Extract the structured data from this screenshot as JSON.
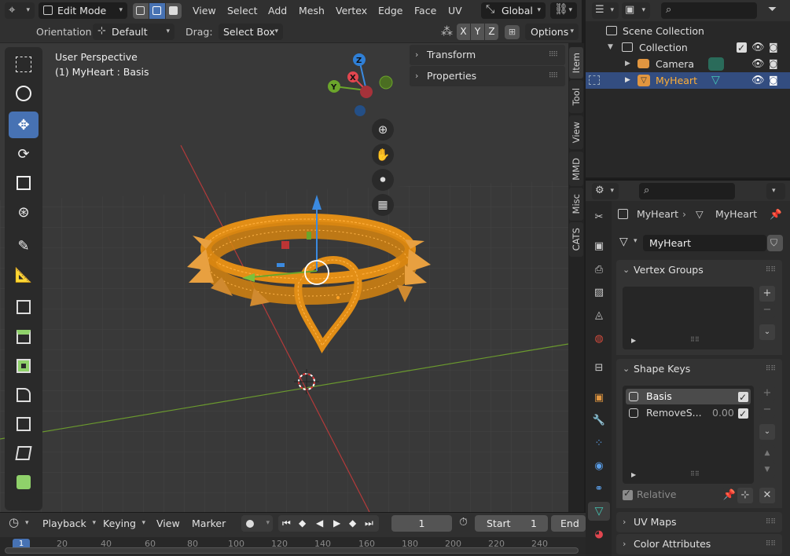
{
  "header": {
    "mode_label": "Edit Mode",
    "menus": [
      "View",
      "Select",
      "Add",
      "Mesh",
      "Vertex",
      "Edge",
      "Face",
      "UV"
    ],
    "transform_orientation": "Global",
    "orientation_label": "Orientation:",
    "orientation_value": "Default",
    "drag_label": "Drag:",
    "drag_value": "Select Box",
    "axis_x": "X",
    "axis_y": "Y",
    "axis_z": "Z",
    "options_label": "Options"
  },
  "viewport": {
    "perspective_label": "User Perspective",
    "object_label": "(1) MyHeart : Basis",
    "gizmo_axes": [
      "X",
      "Y",
      "Z"
    ]
  },
  "npanel": {
    "sections": [
      "Transform",
      "Properties"
    ],
    "tabs": [
      "Item",
      "Tool",
      "View",
      "MMD",
      "Misc",
      "CATS"
    ]
  },
  "outliner": {
    "items": [
      {
        "label": "Scene Collection"
      },
      {
        "label": "Collection"
      },
      {
        "label": "Camera"
      },
      {
        "label": "MyHeart"
      }
    ]
  },
  "properties": {
    "breadcrumb_object": "MyHeart",
    "breadcrumb_data": "MyHeart",
    "mesh_name": "MyHeart",
    "sections": {
      "vertex_groups": "Vertex Groups",
      "shape_keys": "Shape Keys",
      "uv_maps": "UV Maps",
      "color_attributes": "Color Attributes"
    },
    "shape_keys": [
      {
        "name": "Basis",
        "value": ""
      },
      {
        "name": "RemoveS...",
        "value": "0.00"
      }
    ],
    "relative_label": "Relative"
  },
  "timeline": {
    "playback_label": "Playback",
    "keying_label": "Keying",
    "view_label": "View",
    "marker_label": "Marker",
    "current_frame": "1",
    "start_label": "Start",
    "start_value": "1",
    "end_label": "End",
    "ruler_ticks": [
      "1",
      "20",
      "40",
      "60",
      "80",
      "100",
      "120",
      "140",
      "160",
      "180",
      "200",
      "220",
      "240"
    ]
  },
  "colors": {
    "accent_blue": "#4772b3",
    "selection_orange": "#ffa225",
    "axis_red": "#e2464f",
    "axis_green": "#6ba52b",
    "axis_blue": "#2f7fd6"
  }
}
